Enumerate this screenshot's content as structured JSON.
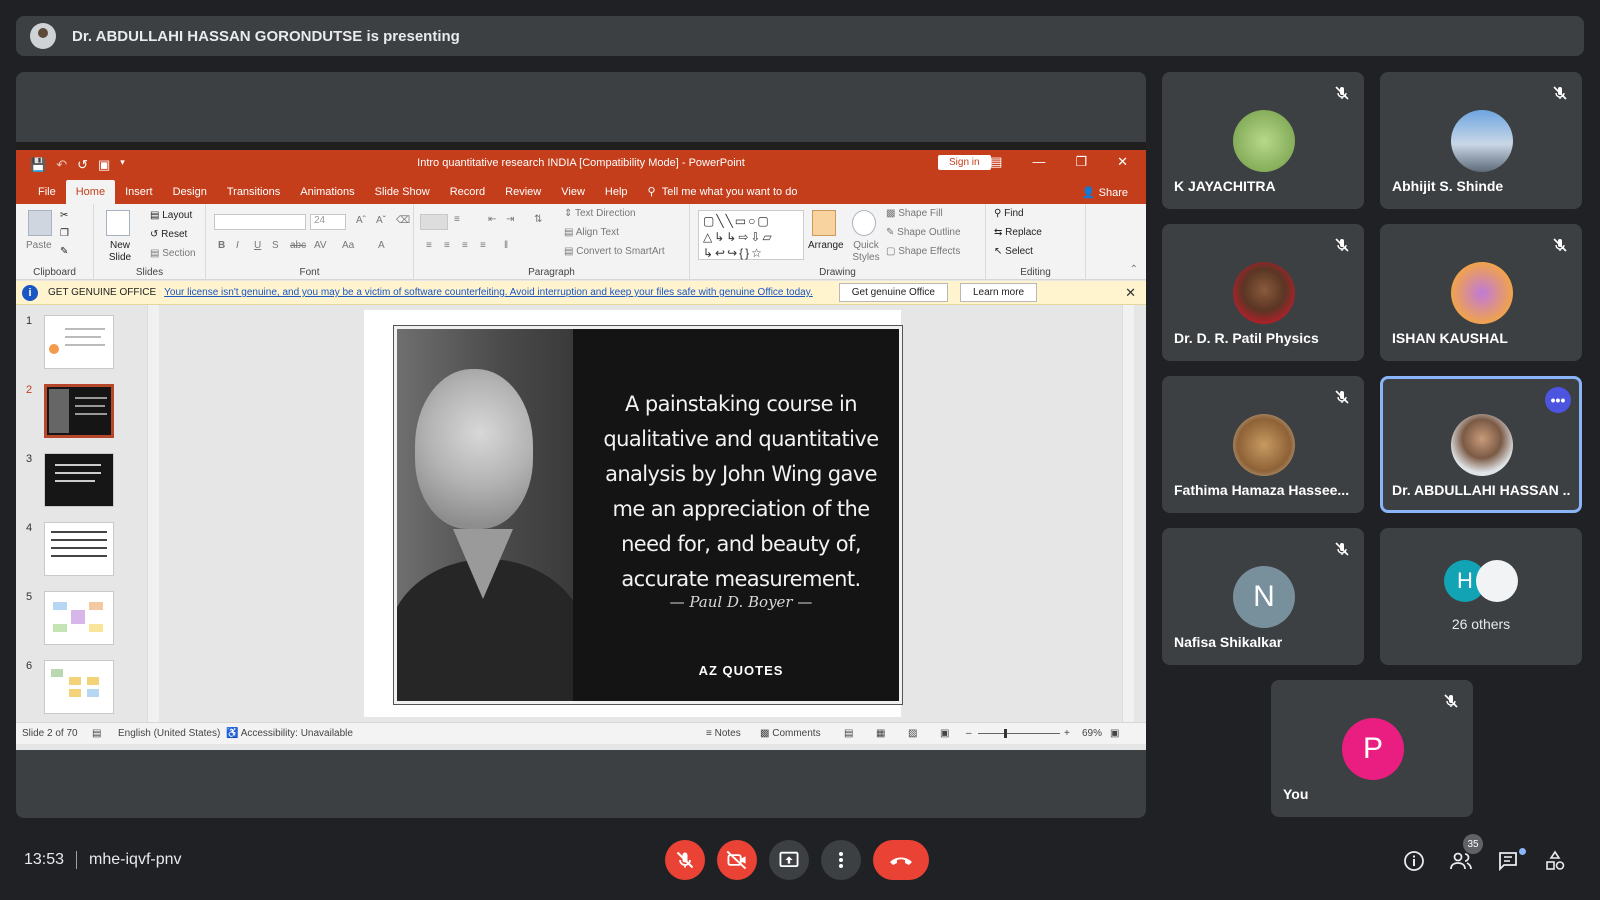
{
  "presenting": {
    "text": "Dr. ABDULLAHI HASSAN GORONDUTSE is presenting"
  },
  "powerpoint": {
    "window_title": "Intro quantitative research INDIA [Compatibility Mode] - PowerPoint",
    "sign_in": "Sign in",
    "tabs": [
      "File",
      "Home",
      "Insert",
      "Design",
      "Transitions",
      "Animations",
      "Slide Show",
      "Record",
      "Review",
      "View",
      "Help"
    ],
    "tell_me": "Tell me what you want to do",
    "share": "Share",
    "ribbon": {
      "paste": "Paste",
      "new_slide": "New Slide",
      "layout": "Layout",
      "reset": "Reset",
      "section": "Section",
      "font_size": "24",
      "text_direction": "Text Direction",
      "align_text": "Align Text",
      "convert_smartart": "Convert to SmartArt",
      "arrange": "Arrange",
      "quick_styles": "Quick Styles",
      "shape_fill": "Shape Fill",
      "shape_outline": "Shape Outline",
      "shape_effects": "Shape Effects",
      "find": "Find",
      "replace": "Replace",
      "select": "Select",
      "groups": [
        "Clipboard",
        "Slides",
        "Font",
        "Paragraph",
        "Drawing",
        "Editing"
      ]
    },
    "genuine_bar": {
      "title": "GET GENUINE OFFICE",
      "message": "Your license isn't genuine, and you may be a victim of software counterfeiting. Avoid interruption and keep your files safe with genuine Office today.",
      "btn_genuine": "Get genuine Office",
      "btn_learn": "Learn more"
    },
    "slide_numbers": [
      "1",
      "2",
      "3",
      "4",
      "5",
      "6"
    ],
    "selected_slide": 2,
    "slide": {
      "quote": "A painstaking course in qualitative and quantitative analysis by John Wing gave me an appreciation of the need for, and beauty of, accurate measurement.",
      "author": "— Paul D. Boyer —",
      "logo": "AZ QUOTES"
    },
    "status": {
      "slide": "Slide 2 of 70",
      "language": "English (United States)",
      "accessibility": "Accessibility: Unavailable",
      "notes": "Notes",
      "comments": "Comments",
      "zoom": "69%"
    }
  },
  "participants": [
    {
      "name": "K JAYACHITRA",
      "muted": true
    },
    {
      "name": "Abhijit S. Shinde",
      "muted": true
    },
    {
      "name": "Dr. D. R. Patil Physics",
      "muted": true
    },
    {
      "name": "ISHAN KAUSHAL",
      "muted": true
    },
    {
      "name": "Fathima Hamaza Hassee...",
      "muted": true
    },
    {
      "name": "Dr. ABDULLAHI HASSAN ...",
      "muted": false,
      "active": true
    },
    {
      "name": "Nafisa Shikalkar",
      "muted": true,
      "initial": "N"
    },
    {
      "others_label": "26 others",
      "initial": "H"
    },
    {
      "name": "You",
      "muted": true,
      "initial": "P"
    }
  ],
  "bottom": {
    "time": "13:53",
    "meeting_code": "mhe-iqvf-pnv",
    "people_count": "35"
  },
  "colors": {
    "accent_red": "#ea4335",
    "pp_orange": "#c43e1c",
    "active_border": "#8ab4f8"
  }
}
